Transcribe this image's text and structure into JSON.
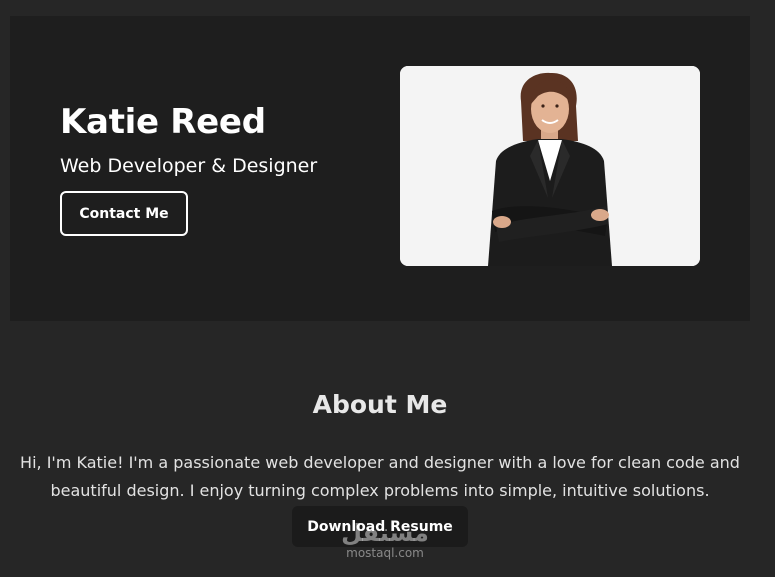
{
  "hero": {
    "name": "Katie Reed",
    "role": "Web Developer & Designer",
    "contact_label": "Contact Me",
    "photo_alt": "Katie Reed"
  },
  "about": {
    "title": "About Me",
    "text": "Hi, I'm Katie! I'm a passionate web developer and designer with a love for clean code and beautiful design. I enjoy turning complex problems into simple, intuitive solutions.",
    "download_label": "Download Resume"
  },
  "watermark": {
    "logo": "مستقل",
    "text": "mostaql.com"
  },
  "colors": {
    "page_bg": "#262626",
    "hero_bg": "#1e1e1e",
    "button_dark": "#1b1b1b",
    "text": "#ffffff"
  }
}
